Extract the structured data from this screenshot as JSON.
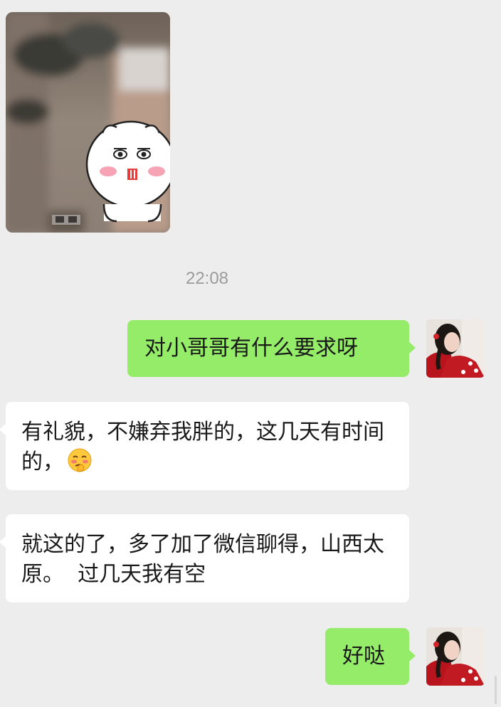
{
  "chat": {
    "timestamp": "22:08",
    "messages": [
      {
        "id": "m1",
        "direction": "outgoing",
        "text": "对小哥哥有什么要求呀"
      },
      {
        "id": "m2",
        "direction": "incoming",
        "text": "有礼貌，不嫌弃我胖的，这几天有时间的，",
        "emoji": "shy-face-emoji"
      },
      {
        "id": "m3",
        "direction": "incoming",
        "text": "就这的了，多了加了微信聊得，山西太原。  过几天我有空"
      },
      {
        "id": "m4",
        "direction": "outgoing",
        "text": "好哒"
      }
    ]
  },
  "colors": {
    "background": "#ededed",
    "outgoing_bubble": "#95ec69",
    "incoming_bubble": "#ffffff",
    "timestamp_text": "#9b9b9b"
  }
}
